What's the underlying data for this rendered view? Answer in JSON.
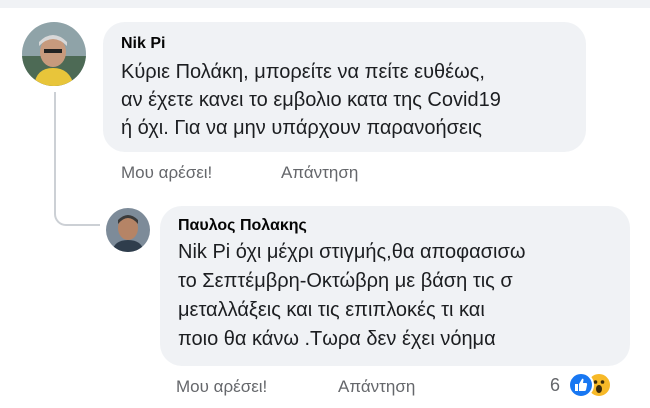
{
  "comment1": {
    "author": "Nik Pi",
    "lines": [
      "Κύριε Πολάκη, μπορείτε να πείτε ευθέως,",
      "αν έχετε κανει το εμβολιο κατα της Covid19",
      "ή όχι. Για να μην υπάρχουν παρανοήσεις"
    ],
    "like_label": "Μου αρέσει!",
    "reply_label": "Απάντηση"
  },
  "comment2": {
    "author": "Παυλος Πολακης",
    "lines": [
      "Nik Pi όχι μέχρι στιγμής,θα αποφασισω",
      "το Σεπτέμβρη-Οκτώβρη με βάση τις σ",
      "μεταλλάξεις και τις επιπλοκές τι και",
      "ποιο θα κάνω .Τωρα δεν έχει νόημα"
    ],
    "like_label": "Μου αρέσει!",
    "reply_label": "Απάντηση",
    "reaction_count": "6",
    "reaction_icons": [
      "like-icon",
      "wow-icon"
    ],
    "reaction_colors": {
      "like": "#1877f2",
      "wow": "#f7b928"
    }
  },
  "colors": {
    "bubble": "#f0f2f5",
    "meta_text": "#65676b",
    "author": "#050505"
  }
}
